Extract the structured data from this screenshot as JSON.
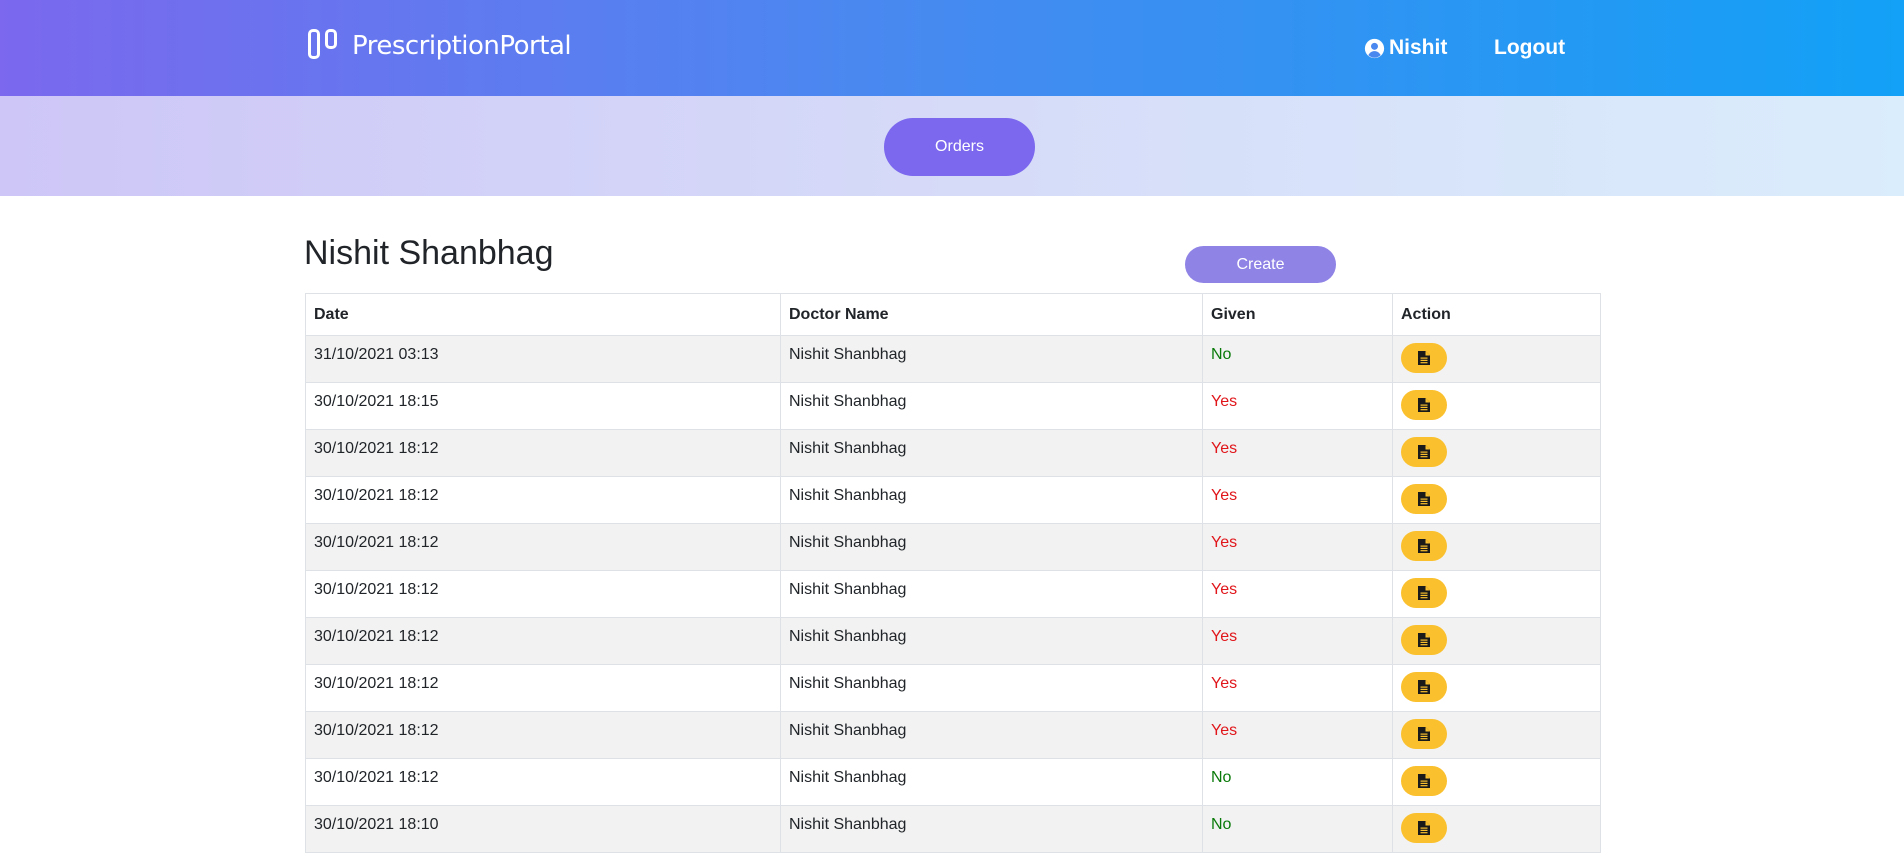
{
  "header": {
    "brand": "PrescriptionPortal",
    "user_name": "Nishit",
    "logout_label": "Logout",
    "gradient": [
      "#7b68ee",
      "#12a1f6"
    ]
  },
  "subnav": {
    "orders_label": "Orders",
    "accent": "#7b68ee"
  },
  "main": {
    "title": "Nishit Shanbhag",
    "create_label": "Create"
  },
  "table": {
    "headers": [
      "Date",
      "Doctor Name",
      "Given",
      "Action"
    ],
    "action_icon": "file-text-icon",
    "action_color": "#fbc02d",
    "rows": [
      {
        "date": "31/10/2021 03:13",
        "doctor": "Nishit Shanbhag",
        "given": "No"
      },
      {
        "date": "30/10/2021 18:15",
        "doctor": "Nishit Shanbhag",
        "given": "Yes"
      },
      {
        "date": "30/10/2021 18:12",
        "doctor": "Nishit Shanbhag",
        "given": "Yes"
      },
      {
        "date": "30/10/2021 18:12",
        "doctor": "Nishit Shanbhag",
        "given": "Yes"
      },
      {
        "date": "30/10/2021 18:12",
        "doctor": "Nishit Shanbhag",
        "given": "Yes"
      },
      {
        "date": "30/10/2021 18:12",
        "doctor": "Nishit Shanbhag",
        "given": "Yes"
      },
      {
        "date": "30/10/2021 18:12",
        "doctor": "Nishit Shanbhag",
        "given": "Yes"
      },
      {
        "date": "30/10/2021 18:12",
        "doctor": "Nishit Shanbhag",
        "given": "Yes"
      },
      {
        "date": "30/10/2021 18:12",
        "doctor": "Nishit Shanbhag",
        "given": "Yes"
      },
      {
        "date": "30/10/2021 18:12",
        "doctor": "Nishit Shanbhag",
        "given": "No"
      },
      {
        "date": "30/10/2021 18:10",
        "doctor": "Nishit Shanbhag",
        "given": "No"
      }
    ]
  }
}
